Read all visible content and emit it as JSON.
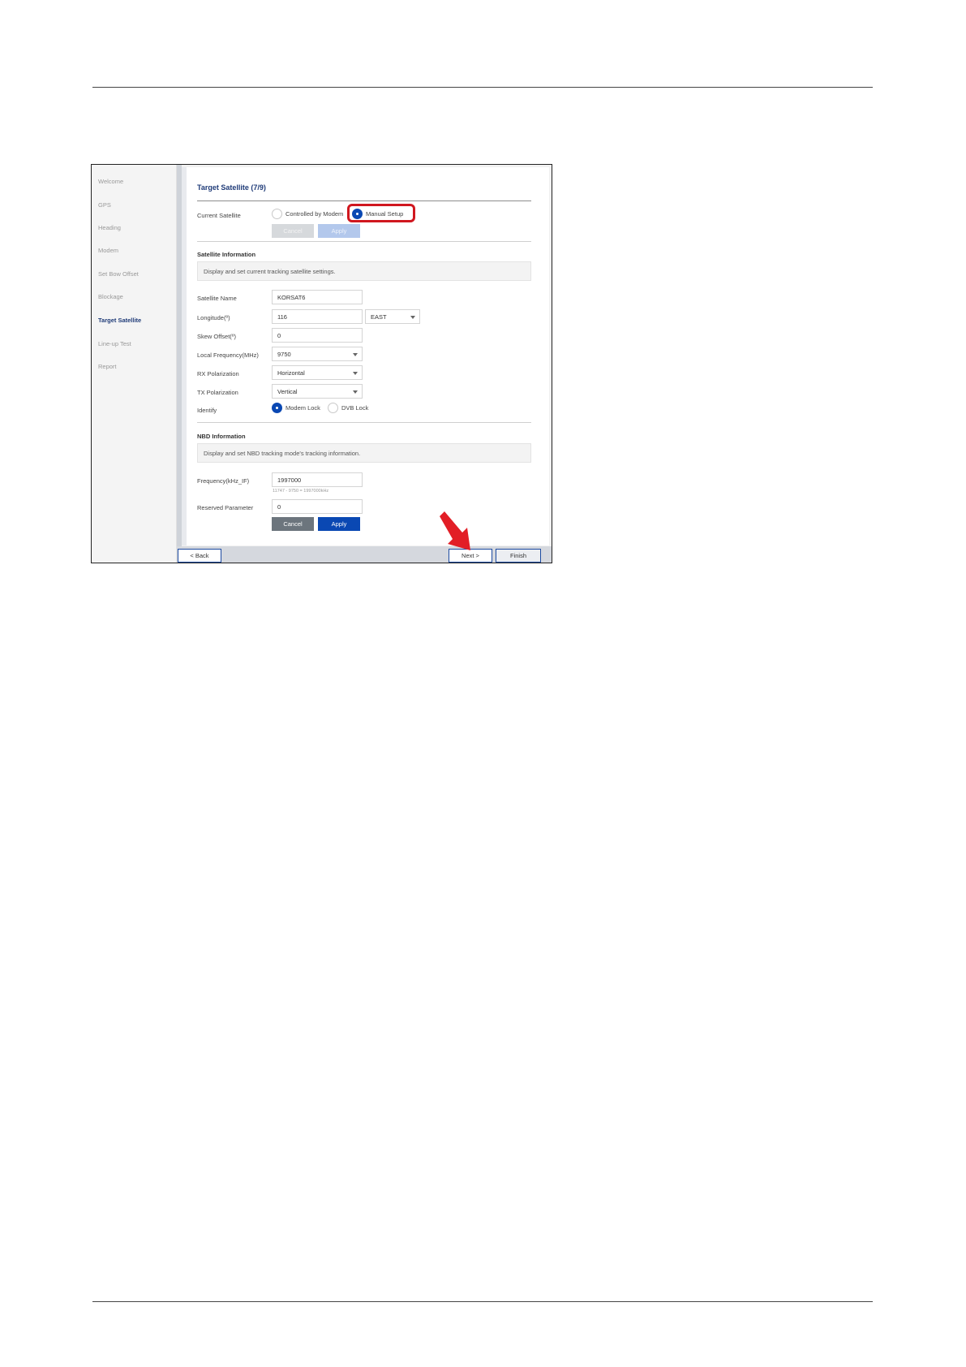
{
  "sidebar": {
    "items": [
      {
        "label": "Welcome"
      },
      {
        "label": "GPS"
      },
      {
        "label": "Heading"
      },
      {
        "label": "Modem"
      },
      {
        "label": "Set Bow Offset"
      },
      {
        "label": "Blockage"
      },
      {
        "label": "Target Satellite"
      },
      {
        "label": "Line-up Test"
      },
      {
        "label": "Report"
      }
    ],
    "active_index": 6
  },
  "panel": {
    "title": "Target Satellite (7/9)",
    "current_satellite": {
      "label": "Current Satellite",
      "option_modem": "Controlled by Modem",
      "option_manual": "Manual Setup",
      "selected": "Manual Setup",
      "cancel_label": "Cancel",
      "apply_label": "Apply"
    },
    "satellite_info": {
      "section_title": "Satellite Information",
      "description": "Display and set current tracking satellite settings.",
      "satellite_name_label": "Satellite Name",
      "satellite_name_value": "KORSAT6",
      "longitude_label": "Longitude(º)",
      "longitude_value": "116",
      "longitude_direction": "EAST",
      "skew_offset_label": "Skew Offset(º)",
      "skew_offset_value": "0",
      "local_frequency_label": "Local Frequency(MHz)",
      "local_frequency_value": "9750",
      "rx_polarization_label": "RX Polarization",
      "rx_polarization_value": "Horizontal",
      "tx_polarization_label": "TX Polarization",
      "tx_polarization_value": "Vertical",
      "identify_label": "Identify",
      "identify_option_modem": "Modem Lock",
      "identify_option_dvb": "DVB Lock",
      "identify_selected": "Modem Lock"
    },
    "nbd_info": {
      "section_title": "NBD Information",
      "description": "Display and set NBD tracking mode's tracking information.",
      "frequency_label": "Frequency(kHz_IF)",
      "frequency_value": "1997000",
      "frequency_hint": "11747 - 9750 = 1997000kHz",
      "reserved_label": "Reserved Parameter",
      "reserved_value": "0",
      "cancel_label": "Cancel",
      "apply_label": "Apply"
    }
  },
  "footer": {
    "back_label": "< Back",
    "next_label": "Next >",
    "finish_label": "Finish"
  },
  "colors": {
    "accent": "#0a48b3",
    "title": "#1f3b78",
    "highlight": "#d0171f",
    "arrow": "#e21e26"
  },
  "annotations": {
    "highlight_target": "Manual Setup",
    "arrow_target": "Next >"
  }
}
